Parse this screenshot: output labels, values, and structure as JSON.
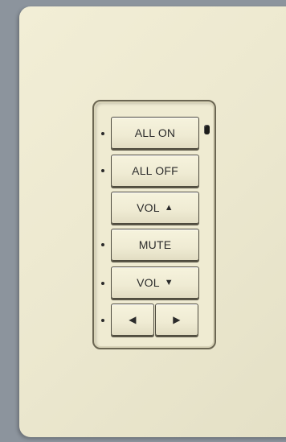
{
  "keypad": {
    "keys": [
      {
        "label": "ALL ON",
        "icon": ""
      },
      {
        "label": "ALL OFF",
        "icon": ""
      },
      {
        "label": "VOL",
        "icon": "▲"
      },
      {
        "label": "MUTE",
        "icon": ""
      },
      {
        "label": "VOL",
        "icon": "▼"
      }
    ],
    "split_key": {
      "left_icon": "◀",
      "right_icon": "▶"
    }
  },
  "colors": {
    "background": "#8c949d",
    "plate": "#efebd2",
    "key_text": "#2b2b2b"
  }
}
